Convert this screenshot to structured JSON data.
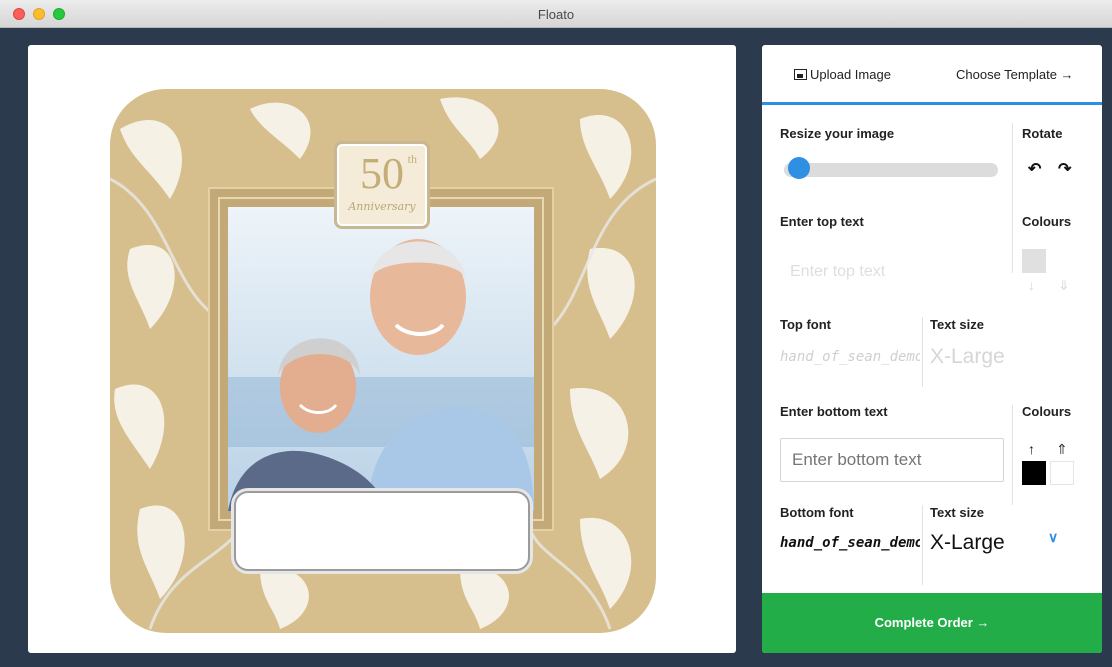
{
  "window": {
    "title": "Floato"
  },
  "canvas": {
    "badge_number": "50",
    "badge_suffix": "th",
    "badge_script": "Anniversary",
    "brand": "floato",
    "colors": {
      "card_gold": "#d6bf8c",
      "frame_gold": "#c4a978"
    }
  },
  "tabs": {
    "upload_label": "Upload Image",
    "upload_icon": "image-icon",
    "template_label": "Choose Template →"
  },
  "resize": {
    "label": "Resize your image",
    "value_fraction": 0.02
  },
  "rotate": {
    "label": "Rotate",
    "left_icon": "↶",
    "right_icon": "↷"
  },
  "top_text": {
    "label": "Enter top text",
    "placeholder": "Enter top text"
  },
  "top_colours": {
    "label": "Colours"
  },
  "top_font": {
    "label": "Top font",
    "value": "hand_of_sean_demo"
  },
  "top_size": {
    "label": "Text size",
    "value": "X-Large"
  },
  "bottom_text": {
    "label": "Enter bottom text",
    "placeholder": "Enter bottom text"
  },
  "bottom_colours": {
    "label": "Colours",
    "selected": "#000000",
    "other": "#ffffff"
  },
  "bottom_font": {
    "label": "Bottom font",
    "value": "hand_of_sean_demo"
  },
  "bottom_size": {
    "label": "Text size",
    "value": "X-Large"
  },
  "complete_button": {
    "label": "Complete Order →",
    "color": "#23ad49"
  },
  "accent": "#2d8ee2"
}
